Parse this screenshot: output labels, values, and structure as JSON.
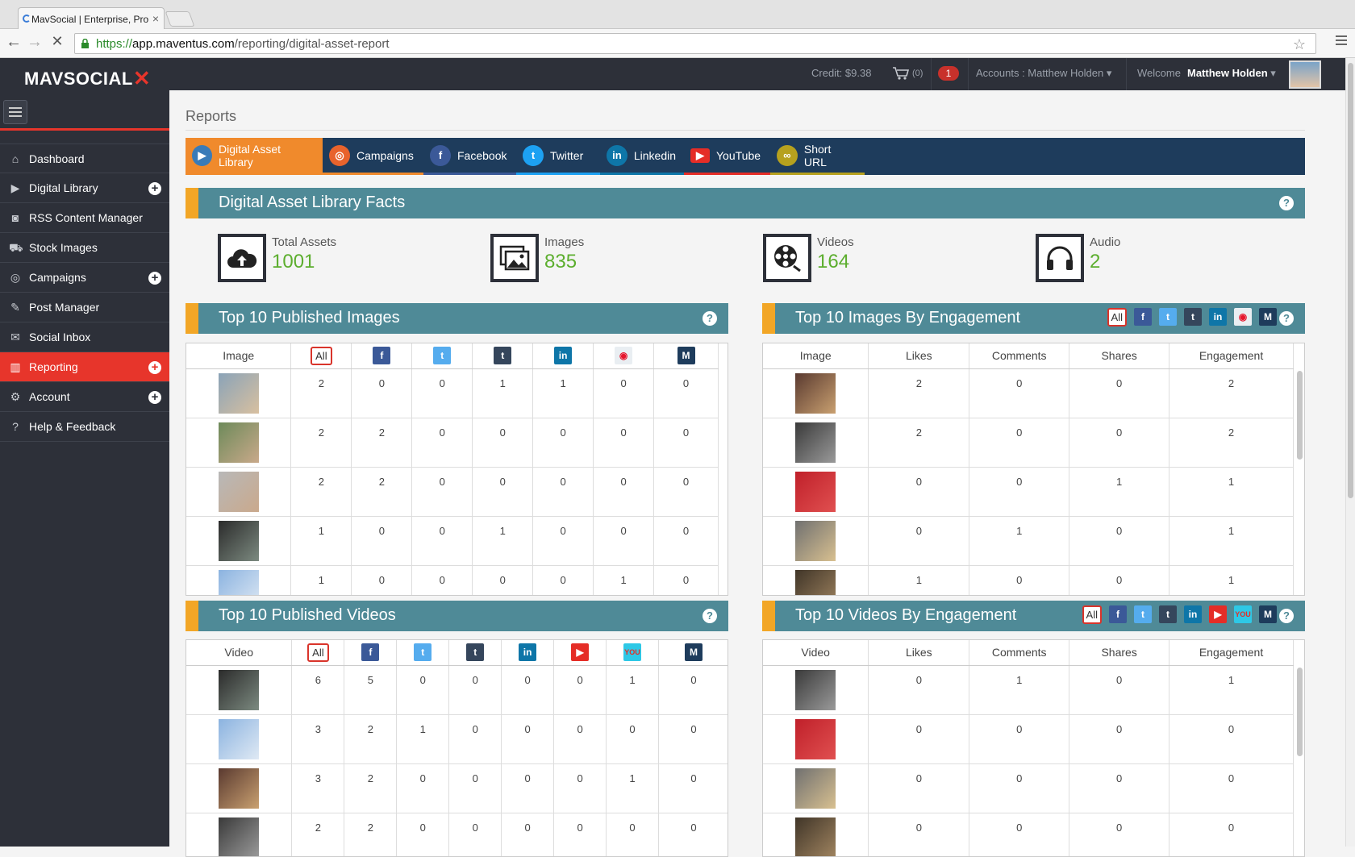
{
  "browser": {
    "tab_title": "MavSocial | Enterprise, Pro",
    "url_scheme": "https://",
    "url_host": "app.maventus.com",
    "url_path": "/reporting/digital-asset-report"
  },
  "header": {
    "logo_text": "MAVSOCIAL",
    "credit": "Credit: $9.38",
    "cart_count": "(0)",
    "notification_count": "1",
    "accounts": "Accounts : Matthew Holden",
    "welcome": "Welcome",
    "user_name": "Matthew Holden"
  },
  "sidebar": {
    "items": [
      {
        "label": "Dashboard",
        "icon": "home-icon"
      },
      {
        "label": "Digital Library",
        "icon": "play-icon"
      },
      {
        "label": "RSS Content Manager",
        "icon": "rss-icon"
      },
      {
        "label": "Stock Images",
        "icon": "cart-icon"
      },
      {
        "label": "Campaigns",
        "icon": "target-icon"
      },
      {
        "label": "Post Manager",
        "icon": "edit-icon"
      },
      {
        "label": "Social Inbox",
        "icon": "envelope-icon"
      },
      {
        "label": "Reporting",
        "icon": "bar-chart-icon"
      },
      {
        "label": "Account",
        "icon": "gear-icon"
      },
      {
        "label": "Help & Feedback",
        "icon": "question-icon"
      }
    ]
  },
  "page": {
    "title": "Reports",
    "tabs": [
      {
        "label": "Digital Asset Library",
        "color": "#3a7bb8",
        "accent": "#f08a2c"
      },
      {
        "label": "Campaigns",
        "color": "#e8632c",
        "accent": "#f08a2c"
      },
      {
        "label": "Facebook",
        "color": "#3b5998",
        "accent": "#3b5998"
      },
      {
        "label": "Twitter",
        "color": "#1da1f2",
        "accent": "#1da1f2"
      },
      {
        "label": "Linkedin",
        "color": "#0e76a8",
        "accent": "#0e76a8"
      },
      {
        "label": "YouTube",
        "color": "#e52d27",
        "accent": "#e52d27"
      },
      {
        "label": "Short URL",
        "color": "#b6a11e",
        "accent": "#b6a11e"
      }
    ]
  },
  "facts": {
    "title": "Digital Asset Library Facts",
    "items": [
      {
        "label": "Total Assets",
        "value": "1001",
        "icon": "cloud-upload-icon"
      },
      {
        "label": "Images",
        "value": "835",
        "icon": "images-icon"
      },
      {
        "label": "Videos",
        "value": "164",
        "icon": "film-reel-icon"
      },
      {
        "label": "Audio",
        "value": "2",
        "icon": "headphones-icon"
      }
    ]
  },
  "published_images": {
    "title": "Top 10 Published Images",
    "col_image": "Image",
    "all_label": "All",
    "networks": [
      "facebook",
      "twitter",
      "tumblr",
      "linkedin",
      "weibo",
      "mavsocial"
    ],
    "rows": [
      [
        2,
        0,
        0,
        1,
        1,
        0,
        0
      ],
      [
        2,
        2,
        0,
        0,
        0,
        0,
        0
      ],
      [
        2,
        2,
        0,
        0,
        0,
        0,
        0
      ],
      [
        1,
        0,
        0,
        1,
        0,
        0,
        0
      ],
      [
        1,
        0,
        0,
        0,
        0,
        1,
        0
      ]
    ]
  },
  "images_engagement": {
    "title": "Top 10 Images By Engagement",
    "columns": [
      "Image",
      "Likes",
      "Comments",
      "Shares",
      "Engagement"
    ],
    "all_label": "All",
    "rows": [
      [
        2,
        0,
        0,
        2
      ],
      [
        2,
        0,
        0,
        2
      ],
      [
        0,
        0,
        1,
        1
      ],
      [
        0,
        1,
        0,
        1
      ],
      [
        1,
        0,
        0,
        1
      ]
    ]
  },
  "published_videos": {
    "title": "Top 10 Published Videos",
    "col_video": "Video",
    "all_label": "All",
    "networks": [
      "facebook",
      "twitter",
      "tumblr",
      "linkedin",
      "youtube",
      "youku",
      "mavsocial"
    ],
    "rows": [
      [
        6,
        5,
        0,
        0,
        0,
        0,
        1,
        0
      ],
      [
        3,
        2,
        1,
        0,
        0,
        0,
        0,
        0
      ],
      [
        3,
        2,
        0,
        0,
        0,
        0,
        1,
        0
      ],
      [
        2,
        2,
        0,
        0,
        0,
        0,
        0,
        0
      ]
    ]
  },
  "videos_engagement": {
    "title": "Top 10 Videos By Engagement",
    "columns": [
      "Video",
      "Likes",
      "Comments",
      "Shares",
      "Engagement"
    ],
    "all_label": "All",
    "rows": [
      [
        0,
        1,
        0,
        1
      ],
      [
        0,
        0,
        0,
        0
      ],
      [
        0,
        0,
        0,
        0
      ],
      [
        0,
        0,
        0,
        0
      ]
    ]
  },
  "colors": {
    "sidebar_bg": "#2d3039",
    "accent_red": "#e7352b",
    "section_header": "#4f8a97",
    "section_marker": "#f2a626",
    "fact_value": "#5cae2e",
    "tabs_bg": "#1e3c5c"
  }
}
